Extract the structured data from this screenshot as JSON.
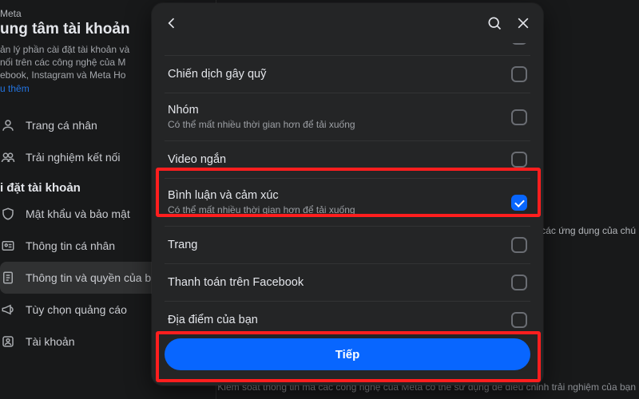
{
  "bg": {
    "brand": "Meta",
    "title": "ung tâm tài khoản",
    "desc1": "ản lý phần cài đặt tài khoản và",
    "desc2": "nối trên các công nghệ của M",
    "desc3": "ebook, Instagram và Meta Ho",
    "link": "u thêm",
    "menu_profiles": "Trang cá nhân",
    "menu_connected": "Trải nghiệm kết nối",
    "section": "i đặt tài khoản",
    "menu_password": "Mật khẩu và bảo mật",
    "menu_personal": "Thông tin cá nhân",
    "menu_yourinfo": "Thông tin và quyền của b",
    "menu_ads": "Tùy chọn quảng cáo",
    "menu_accounts": "Tài khoản",
    "right1": "các ứng dụng của chú",
    "right2": "Kiểm soát thông tin mà các công nghệ của Meta có thể sử dụng để điều chỉnh trải nghiệm của bạn"
  },
  "modal": {
    "rows": [
      {
        "title": "",
        "sub": "",
        "checked": false,
        "cutoff": true
      },
      {
        "title": "Chiến dịch gây quỹ",
        "sub": "",
        "checked": false
      },
      {
        "title": "Nhóm",
        "sub": "Có thể mất nhiều thời gian hơn để tải xuống",
        "checked": false
      },
      {
        "title": "Video ngắn",
        "sub": "",
        "checked": false
      },
      {
        "title": "Bình luận và cảm xúc",
        "sub": "Có thể mất nhiều thời gian hơn để tải xuống",
        "checked": true
      },
      {
        "title": "Trang",
        "sub": "",
        "checked": false
      },
      {
        "title": "Thanh toán trên Facebook",
        "sub": "",
        "checked": false
      },
      {
        "title": "Địa điểm của bạn",
        "sub": "",
        "checked": false
      }
    ],
    "next": "Tiếp"
  }
}
